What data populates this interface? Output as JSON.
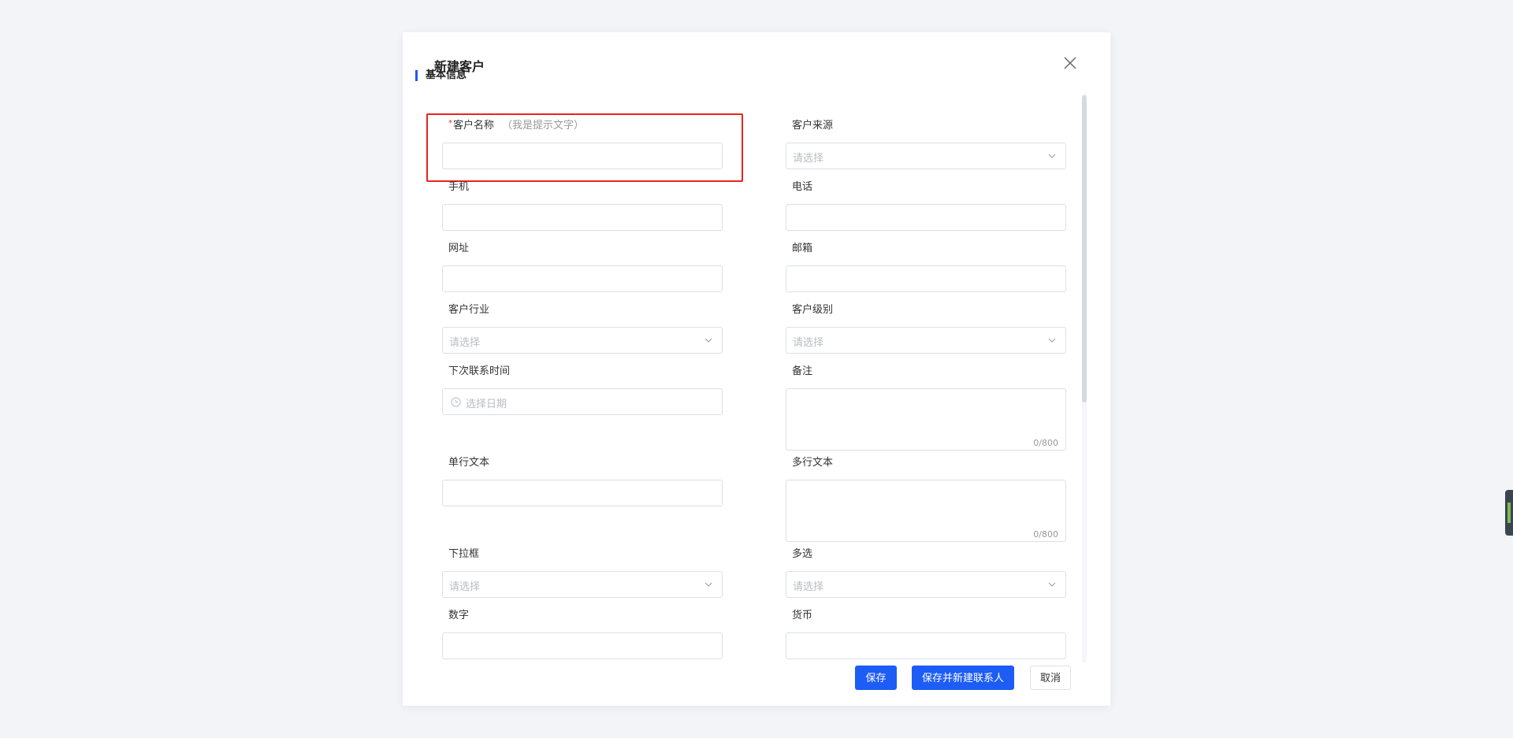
{
  "dialog": {
    "title": "新建客户",
    "section_title": "基本信息"
  },
  "fields": {
    "customer_name": {
      "label": "客户名称",
      "hint": "（我是提示文字）",
      "value": ""
    },
    "customer_source": {
      "label": "客户来源",
      "placeholder": "请选择"
    },
    "mobile": {
      "label": "手机",
      "value": ""
    },
    "phone": {
      "label": "电话",
      "value": ""
    },
    "website": {
      "label": "网址",
      "value": ""
    },
    "email": {
      "label": "邮箱",
      "value": ""
    },
    "industry": {
      "label": "客户行业",
      "placeholder": "请选择"
    },
    "level": {
      "label": "客户级别",
      "placeholder": "请选择"
    },
    "next_contact": {
      "label": "下次联系时间",
      "placeholder": "选择日期"
    },
    "remark": {
      "label": "备注",
      "counter": "0/800"
    },
    "single_text": {
      "label": "单行文本",
      "value": ""
    },
    "multi_text": {
      "label": "多行文本",
      "counter": "0/800"
    },
    "dropdown": {
      "label": "下拉框",
      "placeholder": "请选择"
    },
    "multi_select": {
      "label": "多选",
      "placeholder": "请选择"
    },
    "number": {
      "label": "数字",
      "value": ""
    },
    "currency": {
      "label": "货币",
      "value": ""
    }
  },
  "footer": {
    "save": "保存",
    "save_and_new_contact": "保存并新建联系人",
    "cancel": "取消"
  },
  "colors": {
    "primary": "#1d5cf5",
    "highlight": "#e8231f",
    "required": "#f5222d"
  }
}
